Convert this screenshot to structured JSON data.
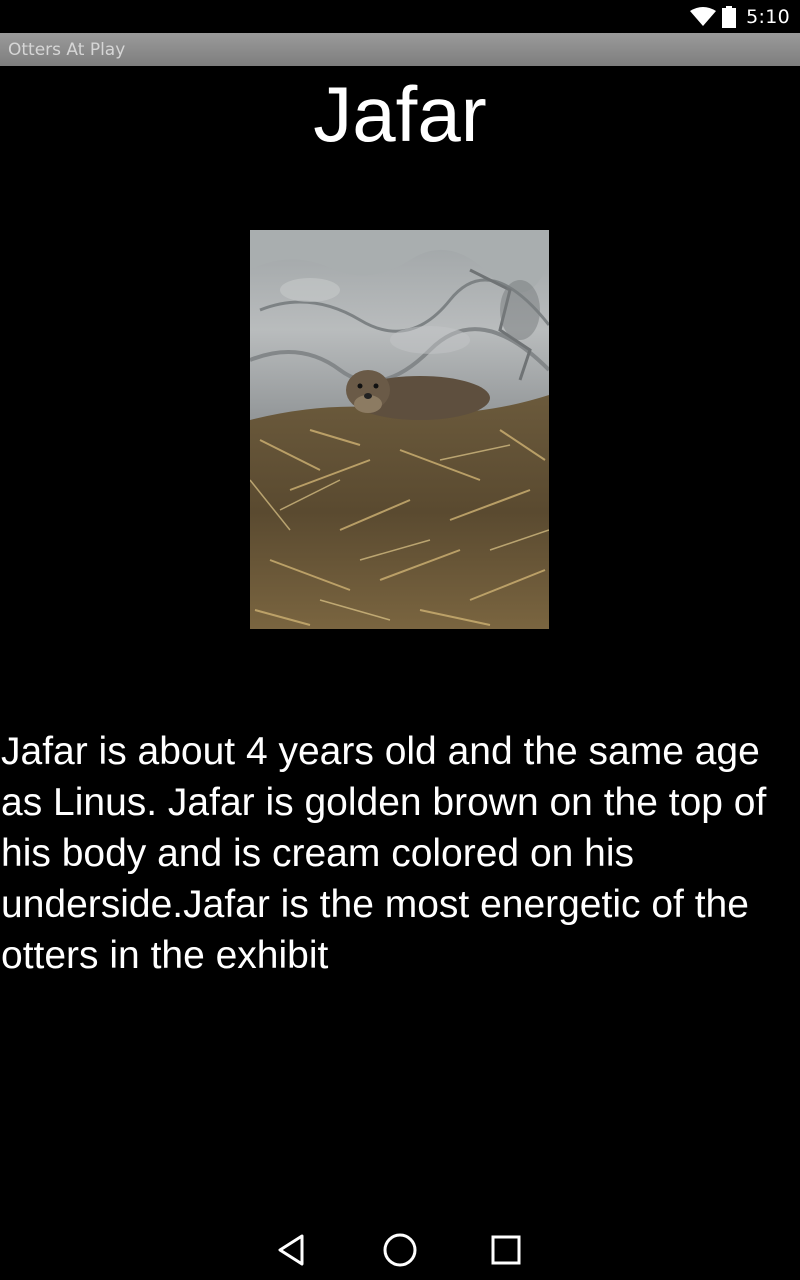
{
  "status_bar": {
    "time": "5:10",
    "icons": [
      "wifi-icon",
      "battery-icon"
    ]
  },
  "app_bar": {
    "title": "Otters At Play"
  },
  "otter": {
    "name": "Jafar",
    "photo_subject": "otter-resting-on-straw",
    "description": "Jafar is about 4 years old and the same age as Linus. Jafar is golden brown on the top of his body and is cream colored on his underside.Jafar is the most energetic of the otters in the exhibit"
  },
  "nav_bar": {
    "buttons": [
      "back-icon",
      "home-icon",
      "recents-icon"
    ]
  },
  "colors": {
    "background": "#000000",
    "text": "#ffffff",
    "app_bar": "#8c8c8c",
    "app_bar_text": "#d6d6d6"
  }
}
